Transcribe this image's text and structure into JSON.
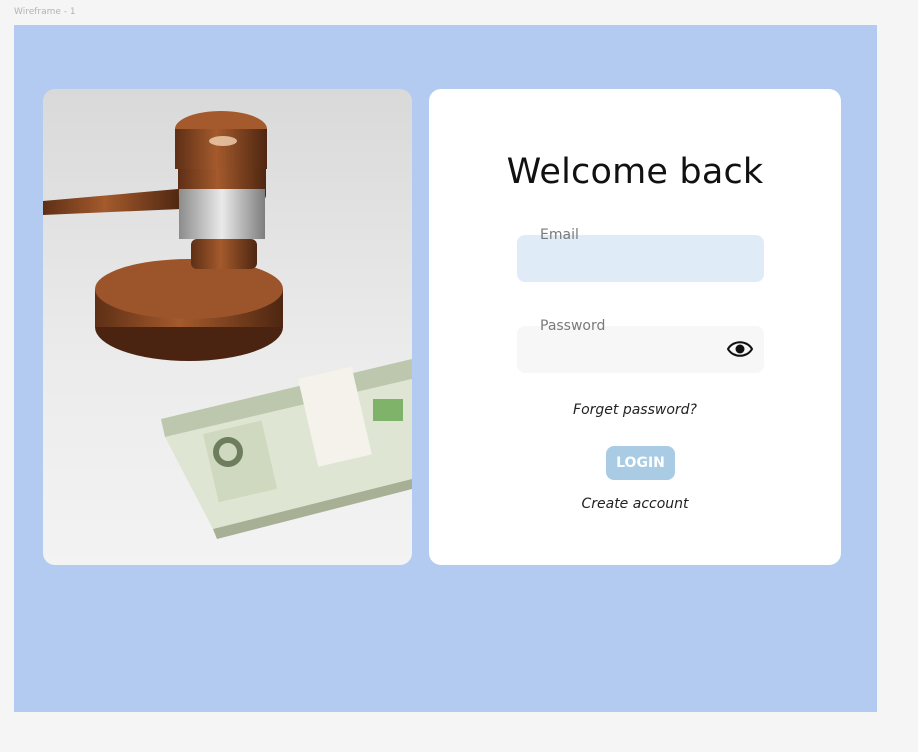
{
  "frame": {
    "label": "Wireframe - 1"
  },
  "login": {
    "title": "Welcome back",
    "email": {
      "label": "Email",
      "value": "",
      "placeholder": ""
    },
    "password": {
      "label": "Password",
      "value": "",
      "placeholder": ""
    },
    "toggle_icon": "eye-icon",
    "forgot_label": "Forget password?",
    "login_label": "LOGIN",
    "create_label": "Create account"
  },
  "image": {
    "subject": "gavel-and-money-illustration"
  },
  "colors": {
    "page_bg": "#f5f5f5",
    "frame_bg": "#b3cbf1",
    "card_bg": "#ffffff",
    "email_field_bg": "#dfebf6",
    "password_field_bg": "#f7f7f7",
    "button_bg": "#a9cbe4",
    "button_text": "#ffffff"
  }
}
